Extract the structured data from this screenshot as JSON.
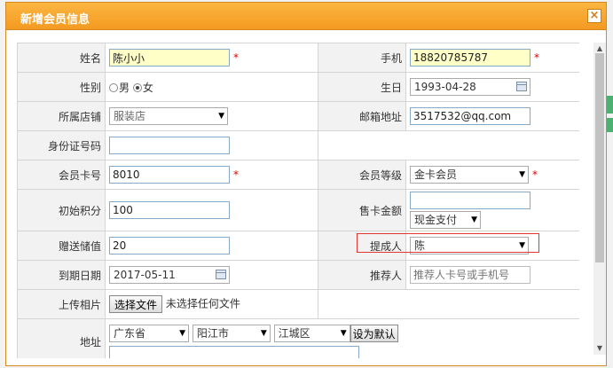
{
  "dialog": {
    "title": "新增会员信息",
    "close_label": "×"
  },
  "form": {
    "name": {
      "label": "姓名",
      "value": "陈小小"
    },
    "phone": {
      "label": "手机",
      "value": "18820785787"
    },
    "gender": {
      "label": "性别",
      "male": "男",
      "female": "女",
      "selected": "女"
    },
    "birthday": {
      "label": "生日",
      "value": "1993-04-28"
    },
    "store": {
      "label": "所属店铺",
      "value": "服装店"
    },
    "email": {
      "label": "邮箱地址",
      "value": "3517532@qq.com"
    },
    "id_number": {
      "label": "身份证号码",
      "value": ""
    },
    "card_no": {
      "label": "会员卡号",
      "value": "8010"
    },
    "level": {
      "label": "会员等级",
      "value": "金卡会员"
    },
    "init_points": {
      "label": "初始积分",
      "value": "100"
    },
    "sale_amount": {
      "label": "售卡金额",
      "value": "",
      "payment": "现金支付"
    },
    "gift_value": {
      "label": "赠送储值",
      "value": "20"
    },
    "commission": {
      "label": "提成人",
      "value": "陈"
    },
    "expire": {
      "label": "到期日期",
      "value": "2017-05-11"
    },
    "referrer": {
      "label": "推荐人",
      "placeholder": "推荐人卡号或手机号"
    },
    "photo": {
      "label": "上传相片",
      "button": "选择文件",
      "status": "未选择任何文件"
    },
    "address": {
      "label": "地址",
      "province": "广东省",
      "city": "阳江市",
      "district": "江城区",
      "default_button": "设为默认",
      "detail": ""
    },
    "required_mark": "*"
  }
}
